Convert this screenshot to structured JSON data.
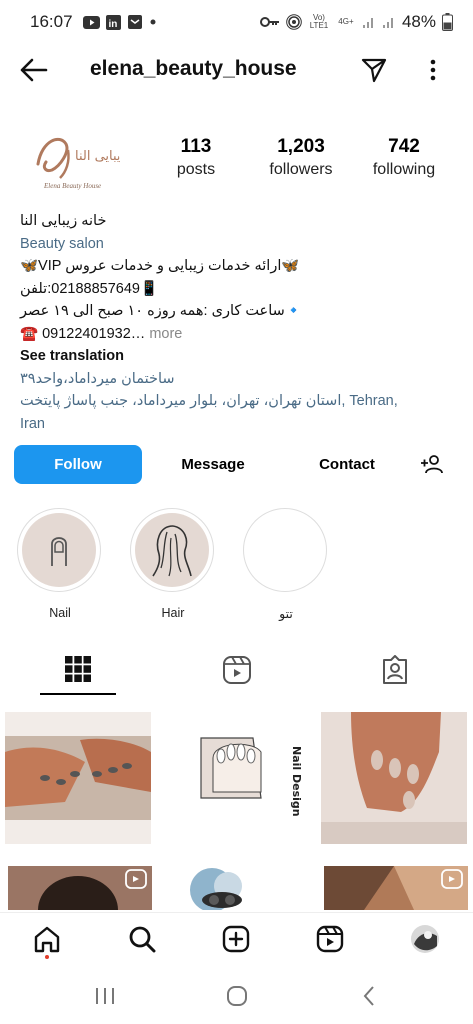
{
  "status": {
    "time": "16:07",
    "battery": "48%",
    "volte": "Vo) LTE1",
    "net": "4G+"
  },
  "appbar": {
    "username": "elena_beauty_house"
  },
  "profile": {
    "logo_text": "خانه زیبایی النا",
    "logo_sub": "Elena Beauty House",
    "stats": [
      {
        "num": "113",
        "label": "posts"
      },
      {
        "num": "1,203",
        "label": "followers"
      },
      {
        "num": "742",
        "label": "following"
      }
    ]
  },
  "bio": {
    "name": "خانه زیبایی النا",
    "category": "Beauty salon",
    "line1": "🦋VIP ارائه خدمات زیبایی و خدمات عروس🦋",
    "line2": "📱02188857649:تلفن",
    "line3": "🔹ساعت کاری :همه روزه ۱۰ صبح الی ۱۹ عصر",
    "line4": "☎️ 09122401932…",
    "more": "more",
    "see_translation": "See translation",
    "addr1": "ساختمان میرداماد،واحد۳۹",
    "addr2": "استان تهران، تهران، بلوار میرداماد، جنب پاساژ پایتخت, Tehran,",
    "addr3": "Iran"
  },
  "actions": {
    "follow": "Follow",
    "message": "Message",
    "contact": "Contact"
  },
  "highlights": [
    {
      "label": "Nail"
    },
    {
      "label": "Hair"
    },
    {
      "label": "تتو"
    }
  ],
  "grid": {
    "nail_design_text": "Nail Design"
  }
}
